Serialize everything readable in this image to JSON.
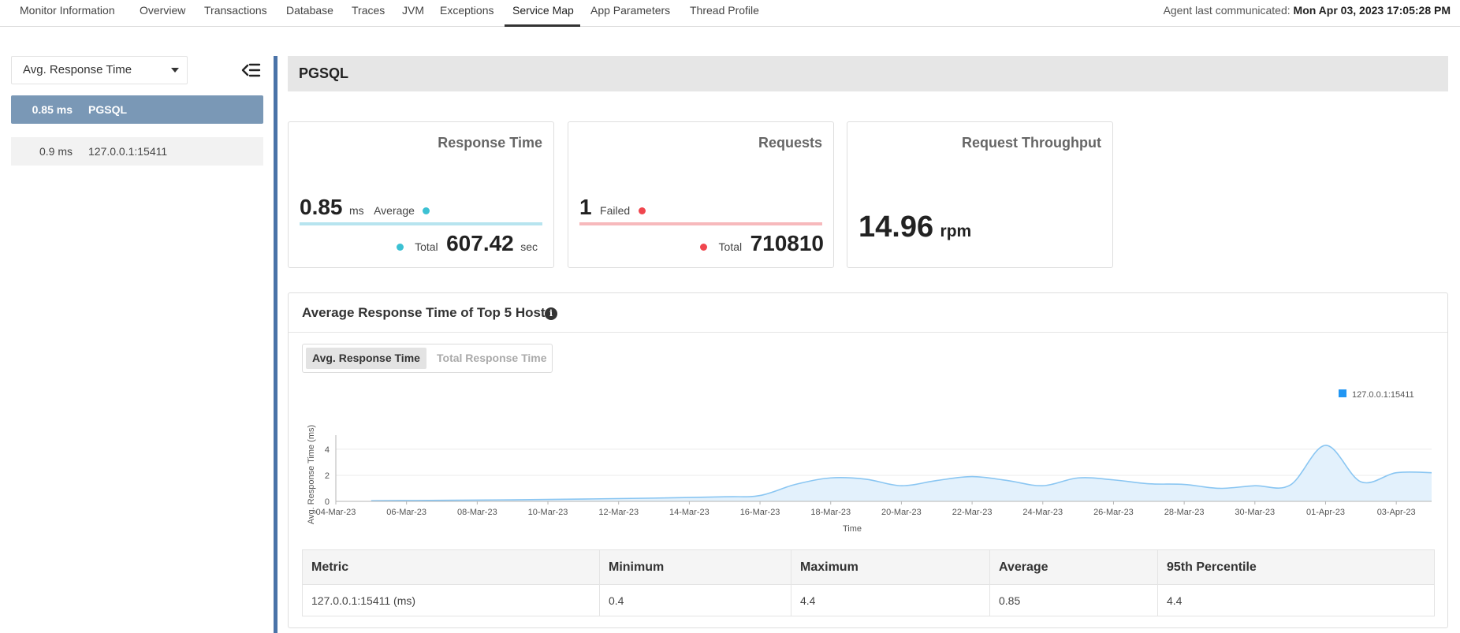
{
  "nav": {
    "tabs": [
      "Monitor Information",
      "Overview",
      "Transactions",
      "Database",
      "Traces",
      "JVM",
      "Exceptions",
      "Service Map",
      "App Parameters",
      "Thread Profile"
    ],
    "active_tab": "Service Map",
    "agent_label": "Agent last communicated:",
    "agent_time": "Mon Apr 03, 2023 17:05:28 PM"
  },
  "sidebar": {
    "metric_select": "Avg. Response Time",
    "items": [
      {
        "value": "0.85 ms",
        "name": "PGSQL",
        "selected": true
      },
      {
        "value": "0.9 ms",
        "name": "127.0.0.1:15411",
        "selected": false
      }
    ]
  },
  "header": {
    "title": "PGSQL"
  },
  "cards": {
    "response_time": {
      "title": "Response Time",
      "avg_value": "0.85",
      "avg_unit": "ms",
      "avg_label": "Average",
      "total_label": "Total",
      "total_value": "607.42",
      "total_unit": "sec",
      "color": "#3cc1d3"
    },
    "requests": {
      "title": "Requests",
      "failed_value": "1",
      "failed_label": "Failed",
      "total_label": "Total",
      "total_value": "710810",
      "color": "#f0464e"
    },
    "throughput": {
      "title": "Request Throughput",
      "value": "14.96",
      "unit": "rpm"
    }
  },
  "chart_panel": {
    "title": "Average Response Time of Top 5 Hosts",
    "toggle": [
      "Avg. Response Time",
      "Total Response Time"
    ],
    "active_toggle": "Avg. Response Time"
  },
  "chart_data": {
    "type": "area",
    "title": "",
    "xlabel": "Time",
    "ylabel": "Avg. Response Time (ms)",
    "ylim": [
      0,
      4.6
    ],
    "yticks": [
      0,
      2,
      4
    ],
    "xlim": [
      "2023-03-04",
      "2023-04-04"
    ],
    "xticks": [
      "04-Mar-23",
      "06-Mar-23",
      "08-Mar-23",
      "10-Mar-23",
      "12-Mar-23",
      "14-Mar-23",
      "16-Mar-23",
      "18-Mar-23",
      "20-Mar-23",
      "22-Mar-23",
      "24-Mar-23",
      "26-Mar-23",
      "28-Mar-23",
      "30-Mar-23",
      "01-Apr-23",
      "03-Apr-23"
    ],
    "grid": true,
    "legend": "top-right",
    "series": [
      {
        "name": "127.0.0.1:15411",
        "color": "#2196f3",
        "fill": "#e3f1fc",
        "line": "#8ac6f2",
        "points": [
          [
            "2023-03-05",
            0.05
          ],
          [
            "2023-03-07",
            0.08
          ],
          [
            "2023-03-09",
            0.12
          ],
          [
            "2023-03-11",
            0.18
          ],
          [
            "2023-03-13",
            0.25
          ],
          [
            "2023-03-15",
            0.35
          ],
          [
            "2023-03-16",
            0.45
          ],
          [
            "2023-03-17",
            1.3
          ],
          [
            "2023-03-18",
            1.8
          ],
          [
            "2023-03-19",
            1.7
          ],
          [
            "2023-03-20",
            1.2
          ],
          [
            "2023-03-21",
            1.6
          ],
          [
            "2023-03-22",
            1.9
          ],
          [
            "2023-03-23",
            1.6
          ],
          [
            "2023-03-24",
            1.2
          ],
          [
            "2023-03-25",
            1.8
          ],
          [
            "2023-03-26",
            1.65
          ],
          [
            "2023-03-27",
            1.35
          ],
          [
            "2023-03-28",
            1.3
          ],
          [
            "2023-03-29",
            1.0
          ],
          [
            "2023-03-30",
            1.2
          ],
          [
            "2023-03-31",
            1.25
          ],
          [
            "2023-04-01",
            4.3
          ],
          [
            "2023-04-02",
            1.5
          ],
          [
            "2023-04-03",
            2.2
          ],
          [
            "2023-04-04",
            2.2
          ]
        ]
      }
    ]
  },
  "metrics_table": {
    "headers": [
      "Metric",
      "Minimum",
      "Maximum",
      "Average",
      "95th Percentile"
    ],
    "rows": [
      [
        "127.0.0.1:15411 (ms)",
        "0.4",
        "4.4",
        "0.85",
        "4.4"
      ]
    ]
  }
}
